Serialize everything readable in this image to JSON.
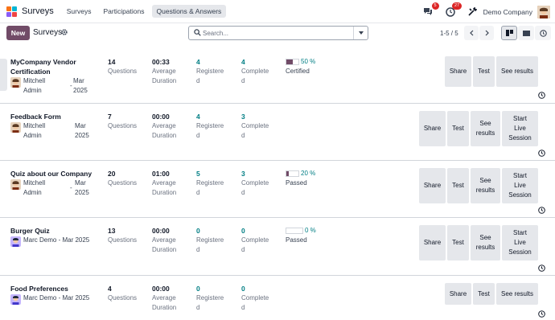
{
  "app": {
    "brand": "Surveys",
    "menu": [
      "Surveys",
      "Participations",
      "Questions & Answers"
    ],
    "active_menu": "Questions & Answers",
    "messages_badge": "5",
    "activity_badge": "27",
    "company": "Demo Company"
  },
  "control": {
    "new_label": "New",
    "breadcrumb": "Surveys",
    "search_placeholder": "Search...",
    "pager": "1-5 / 5"
  },
  "labels": {
    "questions": "Questions",
    "average": "Average",
    "duration": "Duration",
    "registered_1": "Registere",
    "registered_2": "d",
    "completed_1": "Complete",
    "completed_2": "d",
    "share": "Share",
    "test": "Test",
    "see_results": "See results",
    "see": "See",
    "results": "results",
    "start": "Start",
    "live": "Live",
    "session": "Session"
  },
  "surveys": [
    {
      "title_1": "MyCompany Vendor",
      "title_2": "Certification",
      "owner_1": "Mitchell",
      "owner_2": "Admin",
      "date_1": "Mar",
      "date_2": "2025",
      "questions": "14",
      "duration": "00:33",
      "registered": "4",
      "completed": "4",
      "success_pct": "50 %",
      "success_value": 50,
      "success_label": "Certified"
    },
    {
      "title_1": "Feedback Form",
      "owner_1": "Mitchell",
      "owner_2": "Admin",
      "date_1": "Mar",
      "date_2": "2025",
      "questions": "7",
      "duration": "00:00",
      "registered": "4",
      "completed": "3"
    },
    {
      "title_1": "Quiz about our Company",
      "owner_1": "Mitchell",
      "owner_2": "Admin",
      "date_1": "Mar",
      "date_2": "2025",
      "questions": "20",
      "duration": "01:00",
      "registered": "5",
      "completed": "3",
      "success_pct": "20 %",
      "success_value": 20,
      "success_label": "Passed"
    },
    {
      "title_1": "Burger Quiz",
      "owner_line": "Marc Demo - Mar 2025",
      "questions": "13",
      "duration": "00:00",
      "registered": "0",
      "completed": "0",
      "success_pct": "0 %",
      "success_value": 0,
      "success_label": "Passed"
    },
    {
      "title_1": "Food Preferences",
      "owner_line": "Marc Demo - Mar 2025",
      "questions": "4",
      "duration": "00:00",
      "registered": "0",
      "completed": "0"
    }
  ],
  "colors": {
    "brand": "#714B67",
    "teal": "#017e84",
    "badge": "#dc2626"
  }
}
